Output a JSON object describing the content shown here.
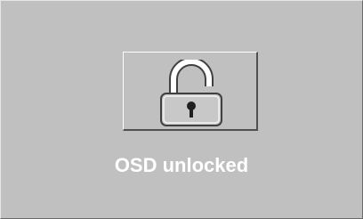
{
  "osd": {
    "status_text": "OSD unlocked",
    "icon": "unlocked-padlock-icon",
    "colors": {
      "panel_background": "#c0c0c0",
      "text": "#ffffff",
      "padlock_body": "#c8c8c8",
      "padlock_outline": "#404040",
      "keyhole": "#202020"
    }
  }
}
